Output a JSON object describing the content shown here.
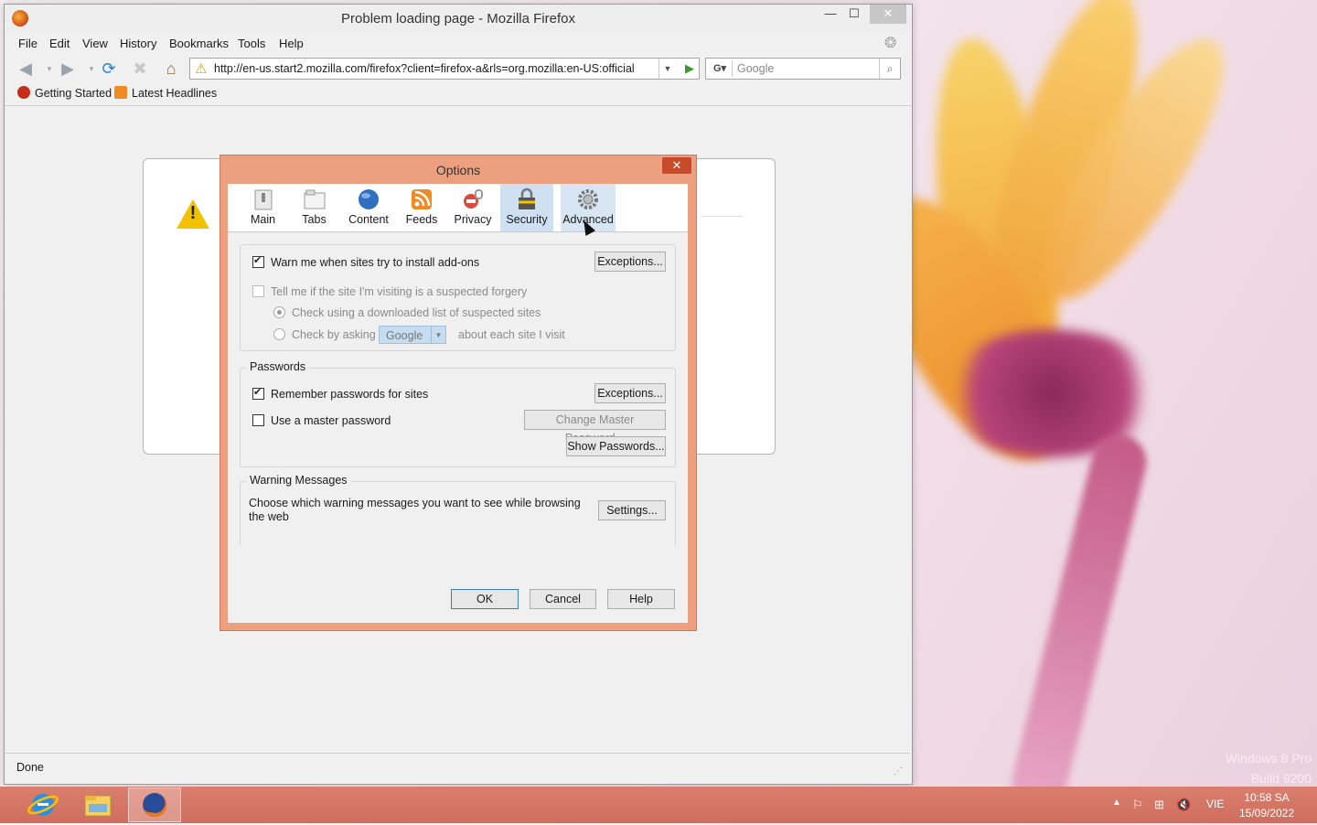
{
  "window": {
    "title": "Problem loading page - Mozilla Firefox"
  },
  "menu": [
    "File",
    "Edit",
    "View",
    "History",
    "Bookmarks",
    "Tools",
    "Help"
  ],
  "navigation": {
    "url": "http://en-us.start2.mozilla.com/firefox?client=firefox-a&rls=org.mozilla:en-US:official",
    "search_engine": "G",
    "search_placeholder": "Google"
  },
  "bookmarks": [
    {
      "label": "Getting Started",
      "icon": "firefox-red-icon"
    },
    {
      "label": "Latest Headlines",
      "icon": "rss-feed-icon"
    }
  ],
  "status": {
    "text": "Done"
  },
  "options_dialog": {
    "title": "Options",
    "close": "✕",
    "tabs": [
      {
        "label": "Main",
        "icon": "switch-icon",
        "active": false
      },
      {
        "label": "Tabs",
        "icon": "tabs-icon",
        "active": false
      },
      {
        "label": "Content",
        "icon": "globe-icon",
        "active": false
      },
      {
        "label": "Feeds",
        "icon": "rss-icon",
        "active": false
      },
      {
        "label": "Privacy",
        "icon": "mask-icon",
        "active": false
      },
      {
        "label": "Security",
        "icon": "padlock-icon",
        "active": true
      },
      {
        "label": "Advanced",
        "icon": "gear-icon",
        "active": false
      }
    ],
    "security": {
      "warn_addons": {
        "label": "Warn me when sites try to install add-ons",
        "checked": true
      },
      "addons_exceptions": "Exceptions...",
      "forgery": {
        "label": "Tell me if the site I'm visiting is a suspected forgery",
        "checked": false
      },
      "radio_downloaded": {
        "label": "Check using a downloaded list of suspected sites",
        "checked": true
      },
      "radio_asking": {
        "label": "Check by asking",
        "checked": false
      },
      "asking_provider": "Google",
      "asking_suffix": "about each site I visit"
    },
    "passwords": {
      "legend": "Passwords",
      "remember": {
        "label": "Remember passwords for sites",
        "checked": true
      },
      "exceptions": "Exceptions...",
      "master": {
        "label": "Use a master password",
        "checked": false
      },
      "change_master": "Change Master Password...",
      "show": "Show Passwords..."
    },
    "warnings": {
      "legend": "Warning Messages",
      "text": "Choose which warning messages you want to see while browsing the web",
      "settings": "Settings..."
    },
    "buttons": {
      "ok": "OK",
      "cancel": "Cancel",
      "help": "Help"
    }
  },
  "desktop": {
    "watermark_line1": "Windows 8 Pro",
    "watermark_line2": "Build 9200"
  },
  "taskbar": {
    "apps": [
      {
        "name": "internet-explorer-icon",
        "active": false
      },
      {
        "name": "file-explorer-icon",
        "active": false
      },
      {
        "name": "firefox-icon",
        "active": true
      }
    ],
    "language": "VIE",
    "time": "10:58 SA",
    "date": "15/09/2022"
  },
  "colors": {
    "dialog_frame": "#eda07f",
    "taskbar": "#d57564",
    "active_tab": "#cfe0f2"
  }
}
